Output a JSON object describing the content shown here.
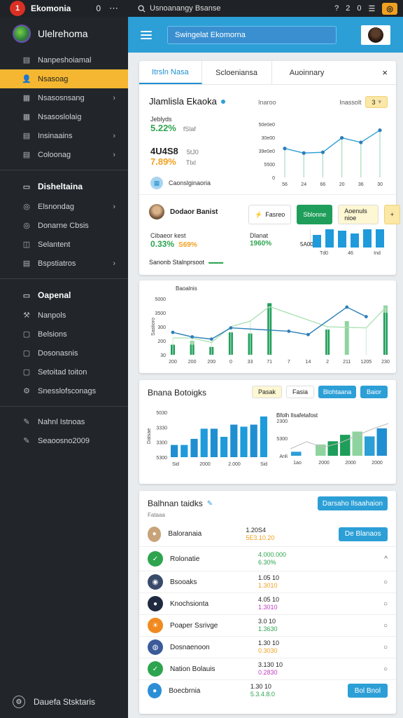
{
  "topbar": {
    "app_name": "Ekomonia",
    "bell": "0",
    "more": "⋯",
    "search_text": "Usnoanangy Bsanse",
    "right_icons": [
      "?",
      "2",
      "0"
    ],
    "badge": "◎"
  },
  "sidebar": {
    "profile_name": "Ulelrehoma",
    "items": [
      {
        "label": "Nanpeshoiamal",
        "icon": "table-icon",
        "chev": "",
        "active": false
      },
      {
        "label": "Nsasoag",
        "icon": "user-icon",
        "chev": "",
        "active": true
      },
      {
        "label": "Nsasosnsang",
        "icon": "grid-icon",
        "chev": "›",
        "active": false
      },
      {
        "label": "Nsasoslolaig",
        "icon": "grid-icon",
        "chev": "",
        "active": false
      },
      {
        "label": "Insinaains",
        "icon": "table-icon",
        "chev": "›",
        "active": false
      },
      {
        "label": "Coloonag",
        "icon": "list-icon",
        "chev": "›",
        "active": false
      }
    ],
    "section1": "Disheltaina",
    "items2": [
      {
        "label": "Elsnondag",
        "chev": "›"
      },
      {
        "label": "Donarne Cbsis",
        "chev": ""
      },
      {
        "label": "Selantent",
        "chev": ""
      },
      {
        "label": "Bspstiatros",
        "chev": "›"
      }
    ],
    "section2": "Oapenal",
    "items3": [
      {
        "label": "Nanpols"
      },
      {
        "label": "Belsions"
      },
      {
        "label": "Dosonasnis"
      },
      {
        "label": "Setoitad toiton"
      },
      {
        "label": "Snesslofsconags"
      }
    ],
    "items4": [
      {
        "label": "Nahnl Istnoas"
      },
      {
        "label": "Seaoosno2009"
      }
    ],
    "footer": "Dauefa Stsktaris"
  },
  "header": {
    "search": "Swingelat Ekomorna"
  },
  "card1": {
    "tabs": [
      "Itrsln Nasa",
      "Scloeniansa",
      "Auoinnary"
    ],
    "close": "×",
    "title": "Jlamlisla Ekaoka",
    "title_right": "Inaroo",
    "filter_label": "Inassolt",
    "filter_value": "3",
    "stat1_label": "Jeblyds",
    "stat1_pct": "5.22%",
    "stat1_note": "fSlaf",
    "stat2_value": "4U4S8",
    "stat2_note": "5tJ0",
    "stat2_pct": "7.89%",
    "stat2_note2": "Tlxl",
    "footer_link": "Caonslginaoria",
    "person_name": "Dodaor Banist",
    "pill1": "Fasreo",
    "pill2": "Sblonne",
    "pill3": "Aoenuls nioe",
    "pill4": "+",
    "sub1_label": "Cibaeor kest",
    "sub1_pct": "0.33%",
    "sub1_pct2": "S69%",
    "sub2_label": "Dlanat",
    "sub2_pct": "1960%",
    "bars_label": "5A00",
    "bottom_text": "Sanonb Stalnprsoot",
    "bottom_tag": "▬▬▬"
  },
  "chart_line_small": {
    "type": "line",
    "x": [
      "56",
      "24",
      "66",
      "20",
      "36",
      "30"
    ],
    "values": [
      38,
      32,
      33,
      52,
      46,
      62
    ],
    "y_ticks": [
      "50e0e0",
      "30e00",
      "39e0e0",
      "5500",
      "0"
    ],
    "ylim": [
      0,
      70
    ]
  },
  "chart_bar_small": {
    "type": "bar",
    "x_ticks": [
      "Td0",
      "46",
      "Ind"
    ],
    "values": [
      18,
      26,
      24,
      20,
      26,
      26
    ]
  },
  "card2": {
    "title": "Baoalnis",
    "y_ticks": [
      "5000",
      "3500",
      "300",
      "200",
      "30"
    ],
    "y_label": "Sastioro",
    "x": [
      "200",
      "200",
      "200",
      "0",
      "33",
      "71",
      "7",
      "14",
      "2",
      "211",
      "1205",
      "230"
    ],
    "bars_green": [
      18,
      18,
      14,
      40,
      38,
      92,
      0,
      0,
      45,
      0,
      0,
      75
    ],
    "bars_light": [
      0,
      25,
      0,
      0,
      0,
      0,
      0,
      0,
      0,
      60,
      0,
      88
    ],
    "line_blue": [
      40,
      32,
      28,
      48,
      0,
      0,
      42,
      36,
      0,
      85,
      68,
      0
    ],
    "line_light": [
      30,
      30,
      22,
      50,
      60,
      86,
      0,
      0,
      50,
      0,
      48,
      84
    ]
  },
  "card3": {
    "title": "Bnana Botoigks",
    "pill1": "Pasak",
    "pill2": "Fasia",
    "pill3": "Blohtaana",
    "pill4": "Baior",
    "left_y": [
      "5030",
      "3330",
      "3300",
      "5300"
    ],
    "left_y_label": "Datsae",
    "left_x": [
      "Sid",
      "2000",
      "2.000",
      "Sid"
    ],
    "left_values": [
      12,
      12,
      18,
      28,
      28,
      20,
      32,
      30,
      32,
      40
    ],
    "right_label": "Bfolh Ilsafetafost",
    "right_y": [
      "2300",
      "5300",
      "Anli"
    ],
    "right_x": [
      "1ao",
      "2000",
      "2000",
      "2000"
    ],
    "right_values": [
      5,
      0,
      14,
      18,
      26,
      30,
      24,
      34
    ],
    "right_line": [
      10,
      20,
      12,
      18,
      28,
      38,
      46
    ]
  },
  "card4": {
    "title": "Balhnan taidks",
    "subtitle": "Fataaa",
    "top_button": "Darsaho Ilsaahaion",
    "rows": [
      {
        "name": "Baloranaia",
        "v1": "1.20S4",
        "v2": "5E3.10.20",
        "v2color": "#f0a020",
        "icon": "person-icon",
        "iconbg": "#c8a37a",
        "right": "De Blanaos",
        "rightType": "button"
      },
      {
        "name": "Rolonatie",
        "v1": "4.000.000",
        "v2": "6.30%",
        "v1color": "#2ea44f",
        "v2color": "#2ea44f",
        "icon": "leaf-icon",
        "iconbg": "#2ea44f",
        "right": "^",
        "rightType": "chevron"
      },
      {
        "name": "Bsooaks",
        "v1": "1.05 10",
        "v2": "1.3010",
        "v2color": "#f0a020",
        "icon": "bulb-icon",
        "iconbg": "#3a4a6a",
        "right": "○",
        "rightType": "radio"
      },
      {
        "name": "Knochsionta",
        "v1": "4.05 10",
        "v2": "1.3010",
        "v2color": "#c03ac0",
        "icon": "coin-icon",
        "iconbg": "#1f2a40",
        "right": "○",
        "rightType": "radio"
      },
      {
        "name": "Poaper Ssrivge",
        "v1": "3.0 10",
        "v2": "1.3630",
        "v2color": "#2ea44f",
        "icon": "sun-icon",
        "iconbg": "#f08a20",
        "right": "○",
        "rightType": "radio"
      },
      {
        "name": "Dosnaenoon",
        "v1": "1.30 10",
        "v2": "0.3030",
        "v2color": "#f0a020",
        "icon": "globe-icon",
        "iconbg": "#3a5a9a",
        "right": "○",
        "rightType": "radio"
      },
      {
        "name": "Nation Bolauis",
        "v1": "3.130 10",
        "v2": "0.2830",
        "v2color": "#c03ac0",
        "icon": "check-icon",
        "iconbg": "#2ea44f",
        "right": "○",
        "rightType": "radio"
      },
      {
        "name": "Boecbrnia",
        "v1": "1.30 10",
        "v2": "5.3.4.8.0",
        "v2color": "#2ea44f",
        "icon": "drop-icon",
        "iconbg": "#2c8fd6",
        "right": "Bol Bnol",
        "rightType": "button"
      }
    ]
  }
}
